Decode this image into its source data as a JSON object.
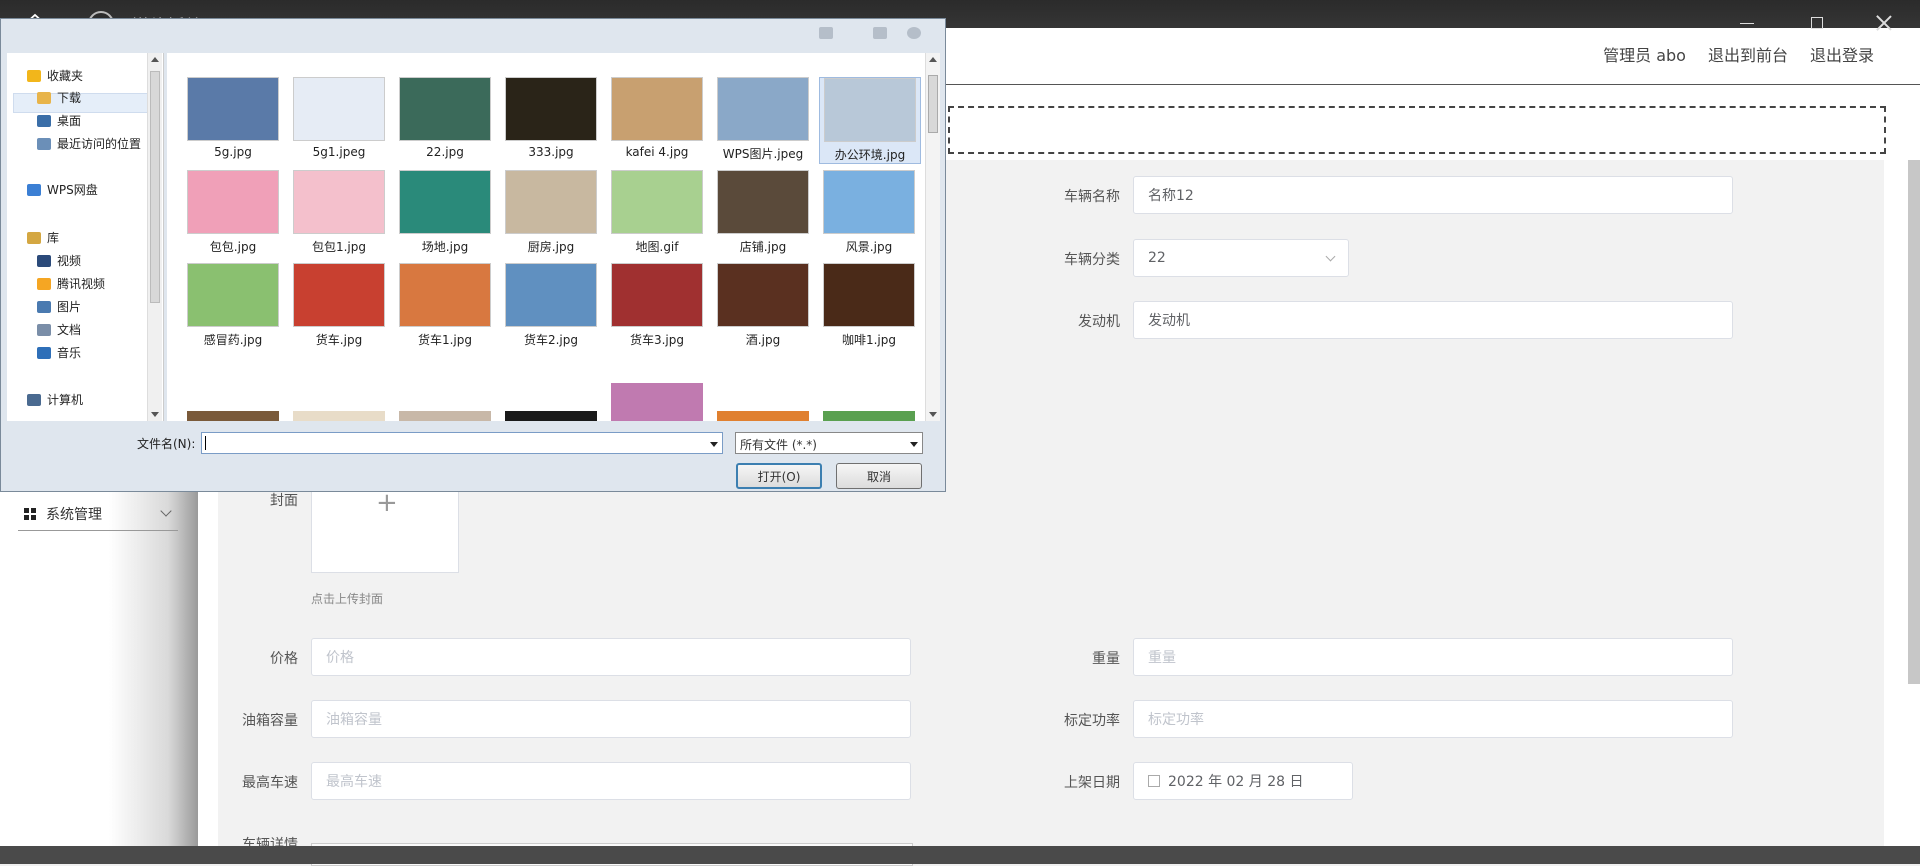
{
  "player": {
    "title": "媒体播放器"
  },
  "web": {
    "header_links": [
      "管理员 abo",
      "退出到前台",
      "退出登录"
    ],
    "sidebar_menu": {
      "label": "系统管理"
    },
    "form": {
      "vehicle_name": {
        "label": "车辆名称",
        "value": "名称12"
      },
      "vehicle_category": {
        "label": "车辆分类",
        "value": "22"
      },
      "engine": {
        "label": "发动机",
        "value": "发动机"
      },
      "cover": {
        "label": "封面",
        "plus": "+",
        "tip": "点击上传封面"
      },
      "price": {
        "label": "价格",
        "placeholder": "价格"
      },
      "weight": {
        "label": "重量",
        "placeholder": "重量"
      },
      "tank": {
        "label": "油箱容量",
        "placeholder": "油箱容量"
      },
      "power": {
        "label": "标定功率",
        "placeholder": "标定功率"
      },
      "max_speed": {
        "label": "最高车速",
        "placeholder": "最高车速"
      },
      "listing_date": {
        "label": "上架日期",
        "value": "2022 年 02 月 28 日"
      },
      "details": {
        "label": "车辆详情"
      }
    }
  },
  "dialog": {
    "nav": [
      {
        "label": "收藏夹",
        "icon": "star-icon",
        "color": "#f2b61b"
      },
      {
        "label": "下载",
        "icon": "download-folder-icon",
        "color": "#e8b44a"
      },
      {
        "label": "桌面",
        "icon": "desktop-icon",
        "color": "#3a6ea8"
      },
      {
        "label": "最近访问的位置",
        "icon": "recent-places-icon",
        "color": "#6b8fb8"
      },
      {
        "label": "WPS网盘",
        "icon": "cloud-icon",
        "color": "#3b7fd4"
      },
      {
        "label": "库",
        "icon": "library-icon",
        "color": "#d4a742"
      },
      {
        "label": "视频",
        "icon": "video-icon",
        "color": "#2b4a7a"
      },
      {
        "label": "腾讯视频",
        "icon": "tencent-video-icon",
        "color": "#f5a623"
      },
      {
        "label": "图片",
        "icon": "pictures-icon",
        "color": "#4a7ab0"
      },
      {
        "label": "文档",
        "icon": "documents-icon",
        "color": "#7a8ea8"
      },
      {
        "label": "音乐",
        "icon": "music-icon",
        "color": "#2e6fb8"
      },
      {
        "label": "计算机",
        "icon": "computer-icon",
        "color": "#4a6a90"
      }
    ],
    "files": [
      {
        "name": "5g.jpg",
        "color": "#5a7aa8"
      },
      {
        "name": "5g1.jpeg",
        "color": "#e6ecf5"
      },
      {
        "name": "22.jpg",
        "color": "#3b6a5a"
      },
      {
        "name": "333.jpg",
        "color": "#2a2418"
      },
      {
        "name": "kafei 4.jpg",
        "color": "#c8a070"
      },
      {
        "name": "WPS图片.jpeg",
        "color": "#8aa8c8"
      },
      {
        "name": "办公环境.jpg",
        "color": "#b8c8d8"
      },
      {
        "name": "包包.jpg",
        "color": "#f0a0b8"
      },
      {
        "name": "包包1.jpg",
        "color": "#f4c0cc"
      },
      {
        "name": "场地.jpg",
        "color": "#2a8a7a"
      },
      {
        "name": "厨房.jpg",
        "color": "#c8b8a0"
      },
      {
        "name": "地图.gif",
        "color": "#a8d090"
      },
      {
        "name": "店铺.jpg",
        "color": "#5a4a3a"
      },
      {
        "name": "风景.jpg",
        "color": "#7ab0e0"
      },
      {
        "name": "感冒药.jpg",
        "color": "#8ac070"
      },
      {
        "name": "货车.jpg",
        "color": "#c84030"
      },
      {
        "name": "货车1.jpg",
        "color": "#d87840"
      },
      {
        "name": "货车2.jpg",
        "color": "#6090c0"
      },
      {
        "name": "货车3.jpg",
        "color": "#a03030"
      },
      {
        "name": "酒.jpg",
        "color": "#5a3020"
      },
      {
        "name": "咖啡1.jpg",
        "color": "#4a2a18"
      }
    ],
    "filename_label": "文件名(N):",
    "filename_value": "",
    "filetype": "所有文件 (*.*)",
    "open_button": "打开(O)",
    "cancel_button": "取消"
  }
}
